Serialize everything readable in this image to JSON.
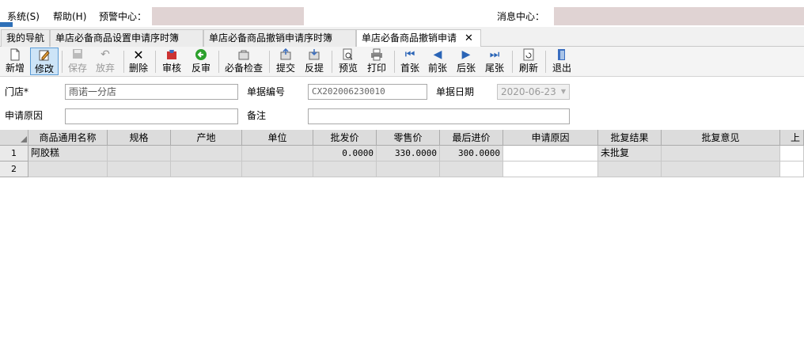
{
  "menubar": {
    "system": "系统(S)",
    "help": "帮助(H)",
    "alert_label": "预警中心：",
    "message_label": "消息中心："
  },
  "tabs": [
    {
      "label": "我的导航"
    },
    {
      "label": "单店必备商品设置申请序时簿"
    },
    {
      "label": "单店必备商品撤销申请序时簿"
    },
    {
      "label": "单店必备商品撤销申请",
      "close": "✕"
    }
  ],
  "toolbar": {
    "new": "新增",
    "edit": "修改",
    "save": "保存",
    "discard": "放弃",
    "delete": "删除",
    "audit": "审核",
    "unaudit": "反审",
    "check": "必备检查",
    "submit": "提交",
    "withdraw": "反提",
    "preview": "预览",
    "print": "打印",
    "first": "首张",
    "prev": "前张",
    "next": "后张",
    "last": "尾张",
    "refresh": "刷新",
    "exit": "退出"
  },
  "form": {
    "store_label": "门店*",
    "store_value": "雨诺一分店",
    "docno_label": "单据编号",
    "docno_value": "CX202006230010",
    "date_label": "单据日期",
    "date_value": "2020-06-23",
    "reason_label": "申请原因",
    "reason_value": "",
    "remark_label": "备注",
    "remark_value": ""
  },
  "grid": {
    "headers": [
      "商品通用名称",
      "规格",
      "产地",
      "单位",
      "批发价",
      "零售价",
      "最后进价",
      "申请原因",
      "批复结果",
      "批复意见",
      "上"
    ],
    "rows": [
      {
        "num": "1",
        "name": "阿胶糕",
        "spec": "",
        "origin": "",
        "unit": "",
        "wholesale": "0.0000",
        "retail": "330.0000",
        "last_cost": "300.0000",
        "reason": "",
        "result": "未批复",
        "opinion": "",
        "extra": ""
      },
      {
        "num": "2",
        "name": "",
        "spec": "",
        "origin": "",
        "unit": "",
        "wholesale": "",
        "retail": "",
        "last_cost": "",
        "reason": "",
        "result": "",
        "opinion": "",
        "extra": ""
      }
    ]
  }
}
